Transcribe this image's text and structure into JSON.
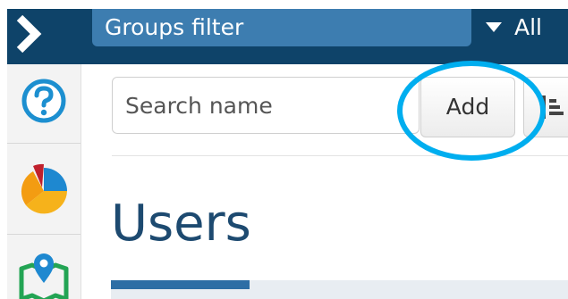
{
  "topbar": {
    "groups_filter_label": "Groups filter",
    "all_label": "All",
    "color": "#0e4369"
  },
  "sidebar": {
    "items": [
      {
        "icon": "help-icon"
      },
      {
        "icon": "pie-chart-icon"
      },
      {
        "icon": "map-pin-icon"
      }
    ]
  },
  "toolbar": {
    "search_placeholder": "Search name",
    "add_label": "Add",
    "sort_icon": "sort-icon"
  },
  "page": {
    "title": "Users"
  },
  "annotation": {
    "highlight_color": "#00aeef",
    "target": "add-button"
  }
}
